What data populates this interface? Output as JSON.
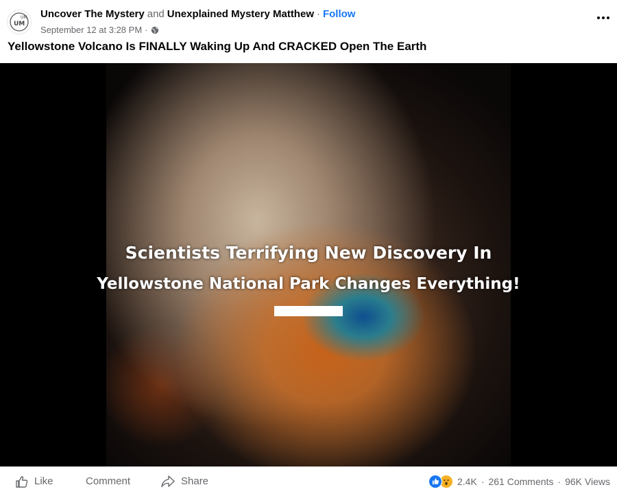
{
  "post": {
    "authors": [
      "Uncover The Mystery",
      "Unexplained Mystery Matthew"
    ],
    "and_text": "and",
    "separator": "·",
    "follow_label": "Follow",
    "timestamp": "September 12 at 3:28 PM",
    "meta_separator": "·",
    "privacy_icon": "globe-icon",
    "more_icon": "more-options-icon",
    "title": "Yellowstone Volcano Is FINALLY Waking Up And CRACKED Open The Earth"
  },
  "video": {
    "overlay_line1": "Scientists Terrifying New Discovery In",
    "overlay_line2": "Yellowstone National Park Changes Everything!"
  },
  "footer": {
    "like_label": "Like",
    "comment_label": "Comment",
    "share_label": "Share",
    "reaction_icons": [
      "like-reaction-icon",
      "wow-reaction-icon"
    ],
    "reactions_count": "2.4K",
    "comments_count": "261 Comments",
    "views_count": "96K Views",
    "separator": "·"
  },
  "colors": {
    "link_blue": "#1877f2",
    "secondary_text": "#65676b",
    "wow_yellow": "#f7b125"
  }
}
